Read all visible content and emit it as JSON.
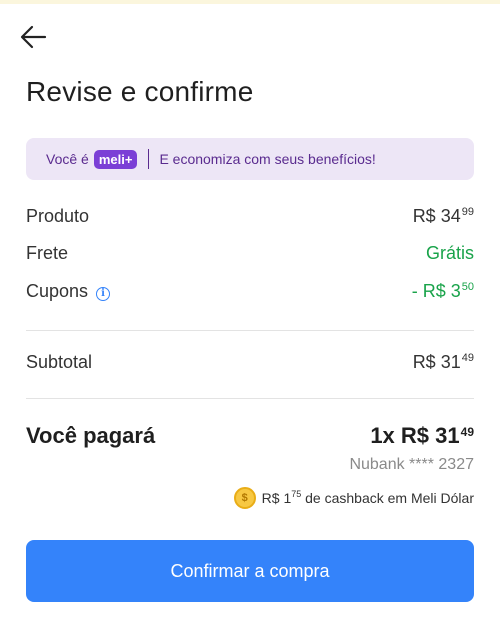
{
  "header": {
    "title": "Revise e confirme"
  },
  "meli_banner": {
    "prefix": "Você é",
    "badge": "meli+",
    "message": "E economiza com seus benefícios!"
  },
  "summary": {
    "produto": {
      "label": "Produto",
      "currency": "R$",
      "int": "34",
      "cents": "99"
    },
    "frete": {
      "label": "Frete",
      "value": "Grátis"
    },
    "cupons": {
      "label": "Cupons",
      "prefix": "- R$",
      "int": "3",
      "cents": "50"
    },
    "subtotal": {
      "label": "Subtotal",
      "currency": "R$",
      "int": "31",
      "cents": "49"
    }
  },
  "payment": {
    "label": "Você pagará",
    "installments": "1x R$",
    "int": "31",
    "cents": "49",
    "card": "Nubank **** 2327",
    "cashback_currency": "R$",
    "cashback_int": "1",
    "cashback_cents": "75",
    "cashback_text": "de cashback em Meli Dólar"
  },
  "actions": {
    "confirm_label": "Confirmar a compra"
  },
  "colors": {
    "primary": "#3483fa",
    "green": "#19a34a",
    "meli_purple": "#7b3fd6",
    "banner_bg": "#ede6f6"
  },
  "icons": {
    "back": "arrow-left-icon",
    "info": "info-icon",
    "coin": "coin-icon"
  }
}
